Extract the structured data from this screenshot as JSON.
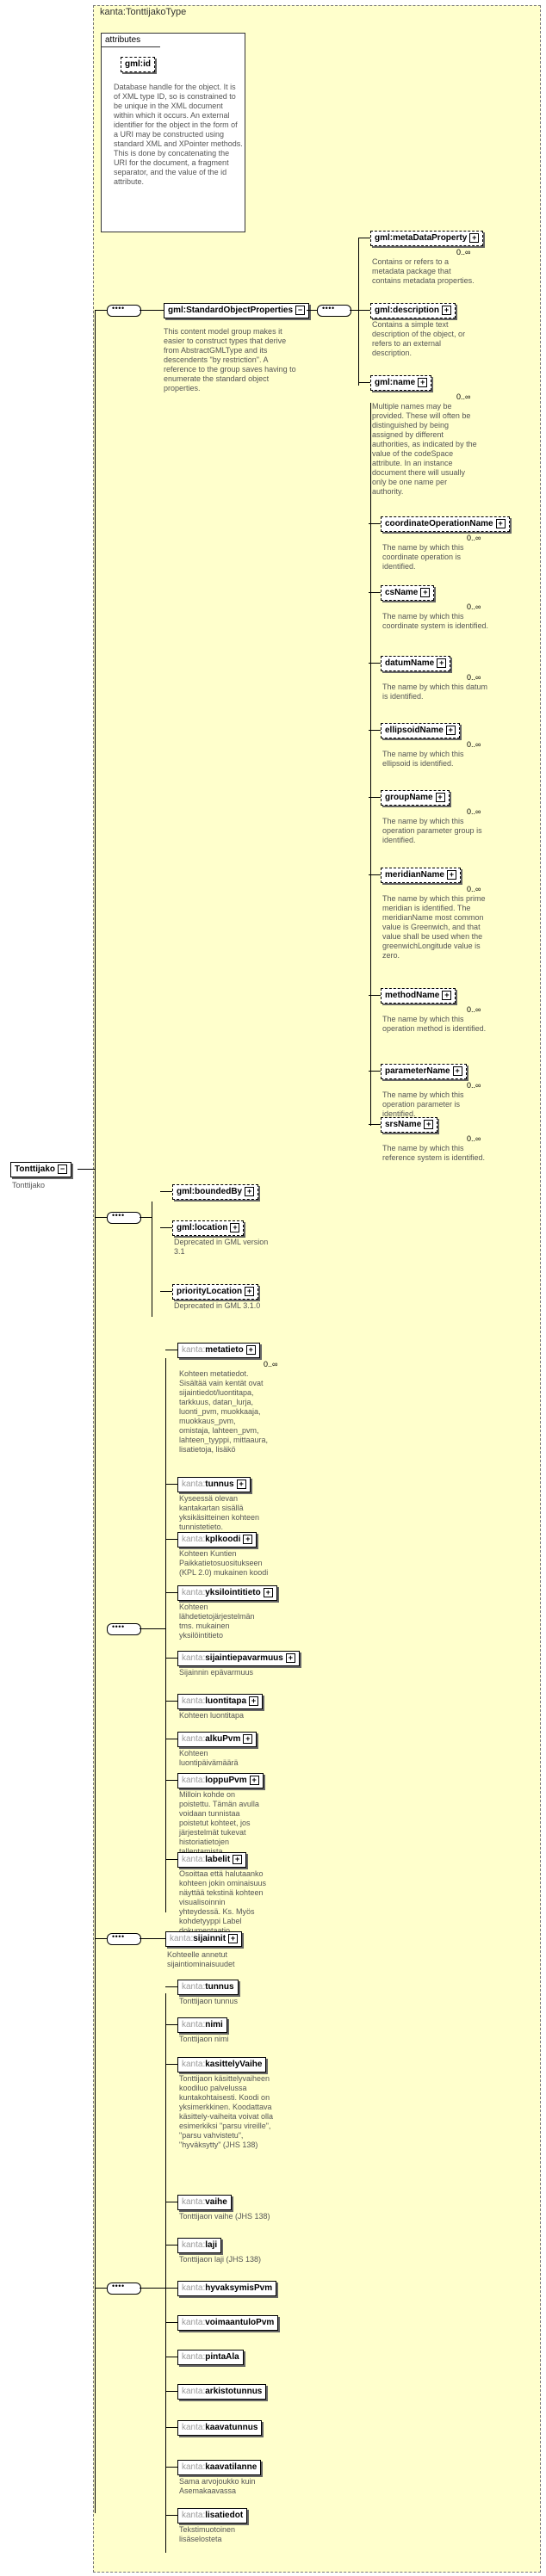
{
  "type_title": "kanta:TonttijakoType",
  "attributes": {
    "header": "attributes",
    "gmlid": {
      "label": "gml:id",
      "desc": "Database handle for the object.  It is of XML type ID, so is constrained to be unique in the XML document within which it occurs.  An external identifier for the object in the form of a URI may be constructed using standard XML and XPointer methods.  This is done by concatenating the URI for the document, a fragment separator, and the value of the id attribute."
    }
  },
  "root": {
    "label": "Tonttijako",
    "desc": "Tonttijako"
  },
  "standard_group": {
    "label": "gml:StandardObjectProperties",
    "desc": "This content model group makes it easier to construct types that derive from AbstractGMLType and its descendents \"by restriction\".  A reference to the group saves having to enumerate the standard object properties."
  },
  "gml_elements": [
    {
      "label": "gml:metaDataProperty",
      "card": "0..∞",
      "desc": "Contains or refers to a metadata package that contains metadata properties."
    },
    {
      "label": "gml:description",
      "card": "",
      "desc": "Contains a simple text description of the object, or refers to an external description."
    },
    {
      "label": "gml:name",
      "card": "0..∞",
      "desc": "Multiple names may be provided.  These will often be distinguished by being assigned by different authorities, as indicated by the value of the codeSpace attribute.  In an instance document there will usually only be one name per authority."
    }
  ],
  "name_subs": [
    {
      "label": "coordinateOperationName",
      "card": "0..∞",
      "desc": "The name by which this coordinate operation is identified."
    },
    {
      "label": "csName",
      "card": "0..∞",
      "desc": "The name by which this coordinate system is identified."
    },
    {
      "label": "datumName",
      "card": "0..∞",
      "desc": "The name by which this datum is identified."
    },
    {
      "label": "ellipsoidName",
      "card": "0..∞",
      "desc": "The name by which this ellipsoid is identified."
    },
    {
      "label": "groupName",
      "card": "0..∞",
      "desc": "The name by which this operation parameter group is identified."
    },
    {
      "label": "meridianName",
      "card": "0..∞",
      "desc": "The name by which this prime meridian is identified. The meridianName most common value is Greenwich, and that value shall be used when the greenwichLongitude value is zero."
    },
    {
      "label": "methodName",
      "card": "0..∞",
      "desc": "The name by which this operation method is identified."
    },
    {
      "label": "parameterName",
      "card": "0..∞",
      "desc": "The name by which this operation parameter is identified."
    },
    {
      "label": "srsName",
      "card": "0..∞",
      "desc": "The name by which this reference system is identified."
    }
  ],
  "gml2": [
    {
      "label": "gml:boundedBy",
      "card": "",
      "desc": ""
    },
    {
      "label": "gml:location",
      "card": "",
      "desc": "Deprecated in GML version 3.1"
    },
    {
      "label": "priorityLocation",
      "card": "",
      "desc": "Deprecated in GML 3.1.0"
    }
  ],
  "kanta_elements": [
    {
      "ns": "kanta:",
      "label": "metatieto",
      "card": "0..∞",
      "desc": "Kohteen metatiedot. Sisältää vain kentät ovat sijaintiedot/luontitapa, tarkkuus, datan_lurja, luonti_pvm, muokkaaja, muokkaus_pvm, omistaja, lahteen_pvm, lahteen_tyyppi, mittaaura, lisatietoja, lisäkö"
    },
    {
      "ns": "kanta:",
      "label": "tunnus",
      "card": "",
      "desc": "Kyseessä olevan kantakartan sisällä yksikäsitteinen kohteen tunnistetieto."
    },
    {
      "ns": "kanta:",
      "label": "kplkoodi",
      "card": "",
      "desc": "Kohteen Kuntien Paikkatietosuositukseen (KPL 2.0) mukainen koodi"
    },
    {
      "ns": "kanta:",
      "label": "yksilointitieto",
      "card": "",
      "desc": "Kohteen lähdetietojärjestelmän  tms. mukainen yksilöintitieto"
    },
    {
      "ns": "kanta:",
      "label": "sijaintiepavarmuus",
      "card": "",
      "desc": "Sijainnin epävarmuus"
    },
    {
      "ns": "kanta:",
      "label": "luontitapa",
      "card": "",
      "desc": "Kohteen luontitapa"
    },
    {
      "ns": "kanta:",
      "label": "alkuPvm",
      "card": "",
      "desc": "Kohteen luontipäivämäärä"
    },
    {
      "ns": "kanta:",
      "label": "loppuPvm",
      "card": "",
      "desc": "Milloin kohde on poistettu. Tämän avulla voidaan tunnistaa poistetut kohteet, jos järjestelmät tukevat historiatietojen tallentamista"
    },
    {
      "ns": "kanta:",
      "label": "labelit",
      "card": "",
      "desc": "Osoittaa että halutaanko kohteen jokin ominaisuus näyttää tekstinä kohteen visualisoinnin yhteydessä.  Ks. Myös kohdetyyppi Label dokumentaatio"
    }
  ],
  "sijainnit": {
    "ns": "kanta:",
    "label": "sijainnit",
    "desc": "Kohteelle annetut sijaintiominaisuudet"
  },
  "tonttijako_elements": [
    {
      "ns": "kanta:",
      "label": "tunnus",
      "card": "",
      "desc": "Tonttijaon tunnus"
    },
    {
      "ns": "kanta:",
      "label": "nimi",
      "card": "",
      "desc": "Tonttijaon nimi"
    },
    {
      "ns": "kanta:",
      "label": "kasittelyVaihe",
      "card": "",
      "desc": "Tonttijaon käsittelyvaiheen koodiluo palvelussa kuntakohtaisesti. Koodi on yksimerkkinen. Koodattava käsittely-vaiheita voivat olla esimerkiksi \"parsu vireille\", \"parsu vahvistetu\", \"hyväksytty\" (JHS 138)"
    },
    {
      "ns": "kanta:",
      "label": "vaihe",
      "card": "",
      "desc": "Tonttijaon vaihe (JHS 138)"
    },
    {
      "ns": "kanta:",
      "label": "laji",
      "card": "",
      "desc": "Tonttijaon laji (JHS 138)"
    },
    {
      "ns": "kanta:",
      "label": "hyvaksymisPvm",
      "card": "",
      "desc": ""
    },
    {
      "ns": "kanta:",
      "label": "voimaantuloPvm",
      "card": "",
      "desc": ""
    },
    {
      "ns": "kanta:",
      "label": "pintaAla",
      "card": "",
      "desc": ""
    },
    {
      "ns": "kanta:",
      "label": "arkistotunnus",
      "card": "",
      "desc": ""
    },
    {
      "ns": "kanta:",
      "label": "kaavatunnus",
      "card": "",
      "desc": ""
    },
    {
      "ns": "kanta:",
      "label": "kaavatilanne",
      "card": "",
      "desc": "Sama arvojoukko kuin Asemakaavassa"
    },
    {
      "ns": "kanta:",
      "label": "lisatiedot",
      "card": "",
      "desc": "Tekstimuotoinen lisäselosteta"
    }
  ]
}
